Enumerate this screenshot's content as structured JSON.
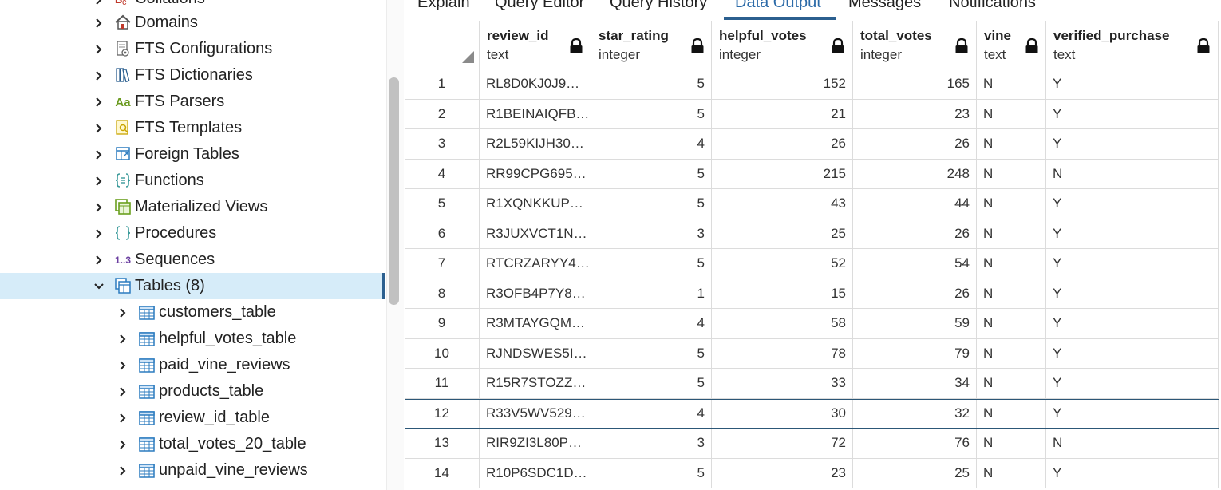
{
  "tree": {
    "items": [
      {
        "label": "Collations",
        "icon": "collations-icon"
      },
      {
        "label": "Domains",
        "icon": "domains-icon"
      },
      {
        "label": "FTS Configurations",
        "icon": "fts-configurations-icon"
      },
      {
        "label": "FTS Dictionaries",
        "icon": "fts-dictionaries-icon"
      },
      {
        "label": "FTS Parsers",
        "icon": "fts-parsers-icon",
        "glyph": "Aa"
      },
      {
        "label": "FTS Templates",
        "icon": "fts-templates-icon"
      },
      {
        "label": "Foreign Tables",
        "icon": "foreign-tables-icon"
      },
      {
        "label": "Functions",
        "icon": "functions-icon"
      },
      {
        "label": "Materialized Views",
        "icon": "materialized-views-icon"
      },
      {
        "label": "Procedures",
        "icon": "procedures-icon"
      },
      {
        "label": "Sequences",
        "icon": "sequences-icon",
        "glyph": "1..3"
      },
      {
        "label": "Tables (8)",
        "icon": "tables-icon",
        "expanded": true,
        "selected": true
      }
    ],
    "tables": [
      "customers_table",
      "helpful_votes_table",
      "paid_vine_reviews",
      "products_table",
      "review_id_table",
      "total_votes_20_table",
      "unpaid_vine_reviews"
    ]
  },
  "tabs": [
    "Explain",
    "Query Editor",
    "Query History",
    "Data Output",
    "Messages",
    "Notifications"
  ],
  "active_tab": "Data Output",
  "columns": [
    {
      "name": "review_id",
      "type": "text"
    },
    {
      "name": "star_rating",
      "type": "integer"
    },
    {
      "name": "helpful_votes",
      "type": "integer"
    },
    {
      "name": "total_votes",
      "type": "integer"
    },
    {
      "name": "vine",
      "type": "text"
    },
    {
      "name": "verified_purchase",
      "type": "text"
    }
  ],
  "rows": [
    [
      "1",
      "RL8D0KJ0J9…",
      "5",
      "152",
      "165",
      "N",
      "Y"
    ],
    [
      "2",
      "R1BEINAIQFB…",
      "5",
      "21",
      "23",
      "N",
      "Y"
    ],
    [
      "3",
      "R2L59KIJH30…",
      "4",
      "26",
      "26",
      "N",
      "Y"
    ],
    [
      "4",
      "RR99CPG695…",
      "5",
      "215",
      "248",
      "N",
      "N"
    ],
    [
      "5",
      "R1XQNKKUP…",
      "5",
      "43",
      "44",
      "N",
      "Y"
    ],
    [
      "6",
      "R3JUXVCT1N…",
      "3",
      "25",
      "26",
      "N",
      "Y"
    ],
    [
      "7",
      "RTCRZARYY4…",
      "5",
      "52",
      "54",
      "N",
      "Y"
    ],
    [
      "8",
      "R3OFB4P7Y8…",
      "1",
      "15",
      "26",
      "N",
      "Y"
    ],
    [
      "9",
      "R3MTAYGQM…",
      "4",
      "58",
      "59",
      "N",
      "Y"
    ],
    [
      "10",
      "RJNDSWES5I…",
      "5",
      "78",
      "79",
      "N",
      "Y"
    ],
    [
      "11",
      "R15R7STOZZ…",
      "5",
      "33",
      "34",
      "N",
      "Y"
    ],
    [
      "12",
      "R33V5WV529…",
      "4",
      "30",
      "32",
      "N",
      "Y"
    ],
    [
      "13",
      "RIR9ZI3L80P…",
      "3",
      "72",
      "76",
      "N",
      "N"
    ],
    [
      "14",
      "R10P6SDC1D…",
      "5",
      "23",
      "25",
      "N",
      "Y"
    ]
  ],
  "highlighted_row": "12",
  "colors": {
    "selected_bg": "#d6ecf9",
    "accent": "#2b5f8f",
    "active_tab_text": "#2b6aa8"
  }
}
